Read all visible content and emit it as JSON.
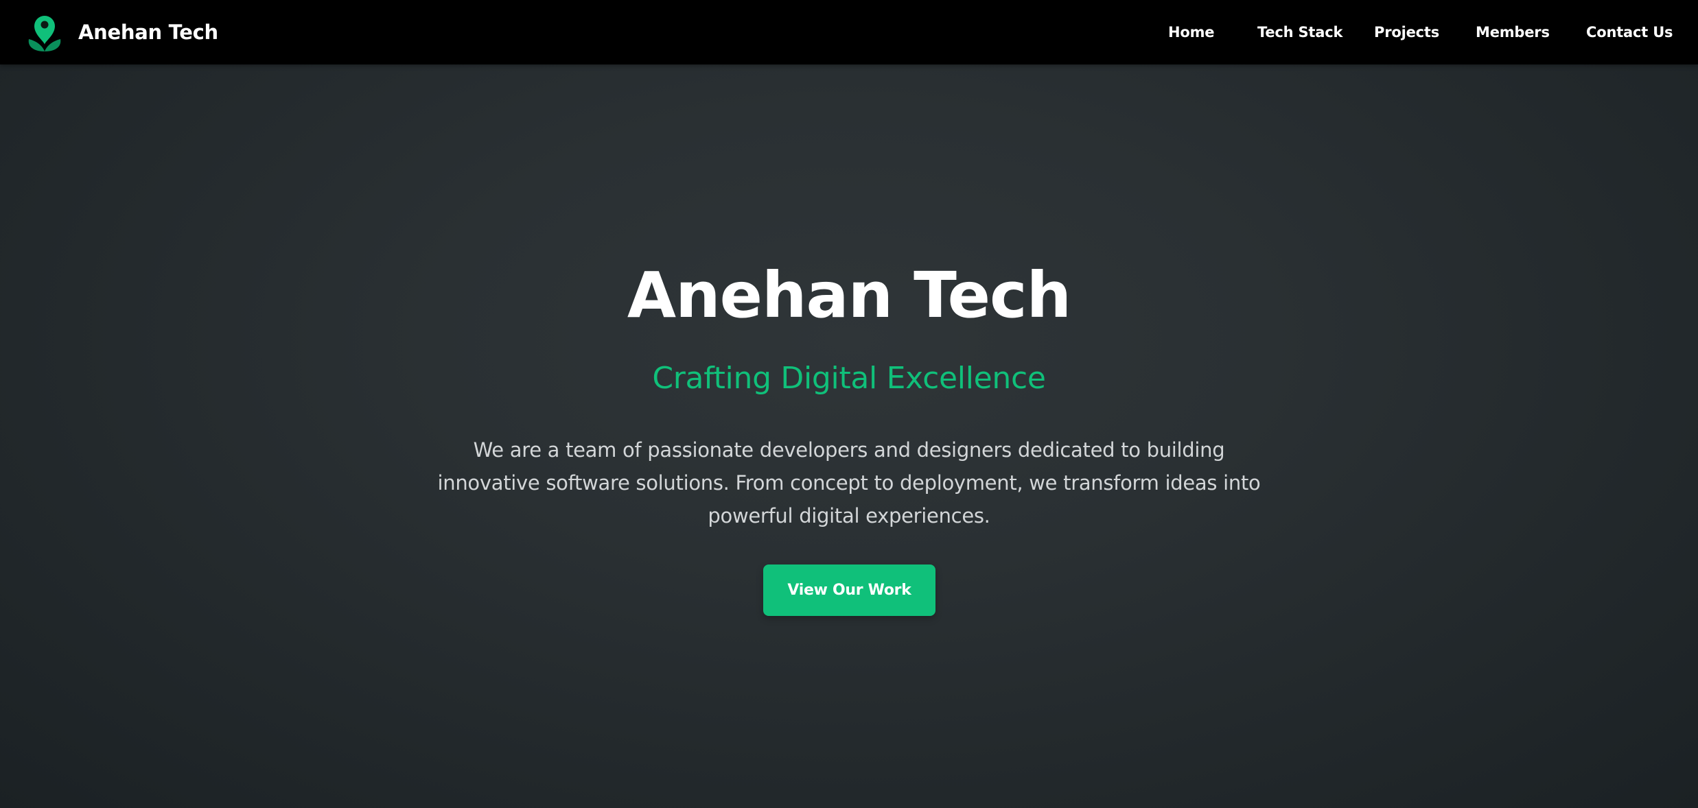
{
  "navbar": {
    "brand_name": "Anehan Tech",
    "logo_icon": "leaf-sprout-pin-icon",
    "links": [
      {
        "label": "Home"
      },
      {
        "label": "Tech Stack"
      },
      {
        "label": "Projects"
      },
      {
        "label": "Members"
      },
      {
        "label": "Contact Us"
      }
    ]
  },
  "hero": {
    "title": "Anehan Tech",
    "subtitle": "Crafting Digital Excellence",
    "description": "We are a team of passionate developers and designers dedicated to building innovative software solutions. From concept to deployment, we transform ideas into powerful digital experiences.",
    "cta_label": "View Our Work"
  },
  "colors": {
    "accent": "#10c07a",
    "navbar_bg": "#000000",
    "hero_bg": "#2a3033",
    "text_primary": "#ffffff",
    "text_secondary": "#d3d6d8"
  }
}
